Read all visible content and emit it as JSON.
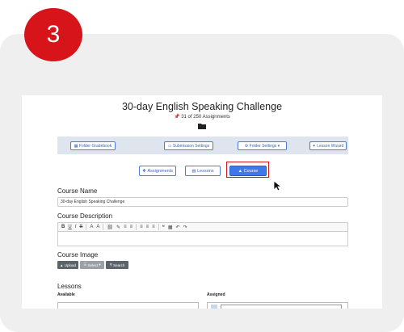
{
  "step_badge": "3",
  "page": {
    "title": "30-day English Speaking Challenge",
    "subtitle": "31 of 250 Assignments",
    "pin_icon": "pin-icon",
    "folder_icon": "folder-icon"
  },
  "toolbar": {
    "folder_gradebook": "Folder Gradebook",
    "submission_settings": "Submission Settings",
    "folder_settings": "Folder Settings",
    "lesson_wizard": "Lesson Wizard"
  },
  "tabs": {
    "assignments": "Assignments",
    "lessons": "Lessons",
    "course": "Course",
    "active": "Course"
  },
  "course_name": {
    "label": "Course Name",
    "value": "30-day English Speaking Challenge"
  },
  "course_description": {
    "label": "Course Description",
    "editor_buttons": [
      "B",
      "U",
      "I",
      "S",
      "A",
      "A",
      "⛓",
      "✎",
      "≡",
      "≡",
      "≡",
      "≡",
      "≡",
      "❝",
      "▦",
      "↶",
      "↷"
    ]
  },
  "course_image": {
    "label": "Course Image",
    "upload": "Upload",
    "select": "Select",
    "search": "Search"
  },
  "lessons": {
    "label": "Lessons",
    "available": "Available",
    "assigned": "Assigned"
  },
  "colors": {
    "badge": "#d8141b",
    "accent": "#3e78ea",
    "highlight": "#d8141b"
  }
}
